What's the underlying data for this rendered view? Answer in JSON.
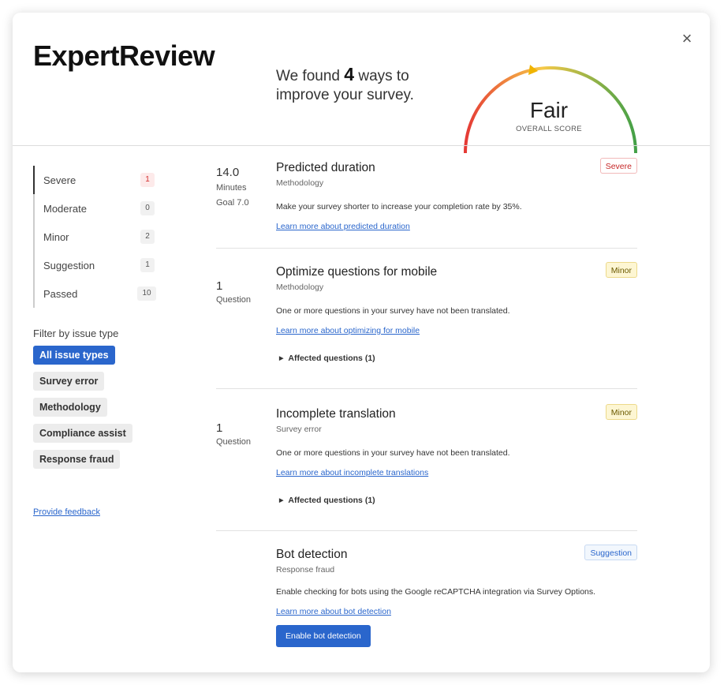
{
  "header": {
    "brand": "ExpertReview",
    "close_icon": "×",
    "found_prefix": "We found ",
    "found_count": "4",
    "found_suffix": " ways to improve your survey.",
    "score_label": "Fair",
    "score_caption": "OVERALL SCORE"
  },
  "gauge": {
    "colors": [
      "#e53935",
      "#f7c948",
      "#43a047"
    ],
    "level": 0.37
  },
  "severity": [
    {
      "label": "Severe",
      "count": "1",
      "count_color": "#d32f2f"
    },
    {
      "label": "Moderate",
      "count": "0"
    },
    {
      "label": "Minor",
      "count": "2"
    },
    {
      "label": "Suggestion",
      "count": "1"
    },
    {
      "label": "Passed",
      "count": "10"
    }
  ],
  "filter": {
    "title": "Filter by issue type",
    "chips": [
      "All issue types",
      "Survey error",
      "Methodology",
      "Compliance assist",
      "Response fraud"
    ]
  },
  "feedback_link": "Provide feedback",
  "cards": [
    {
      "metric": "14.0",
      "metric_sub": "Minutes",
      "metric_goal": "Goal 7.0",
      "title": "Predicted duration",
      "category": "Methodology",
      "badge": "Severe",
      "description": "Make your survey shorter to increase your completion rate by 35%.",
      "link": "Learn more about predicted duration"
    },
    {
      "metric": "1",
      "metric_sub": "Question",
      "title": "Optimize questions for mobile",
      "category": "Methodology",
      "badge": "Minor",
      "description": "One or more questions in your survey have not been translated.",
      "link": "Learn more about optimizing for mobile",
      "affected": "Affected questions (1)"
    },
    {
      "metric": "1",
      "metric_sub": "Question",
      "title": "Incomplete translation",
      "category": "Survey error",
      "badge": "Minor",
      "description": "One or more questions in your survey have not been translated.",
      "link": "Learn more about incomplete translations",
      "affected": "Affected questions (1)"
    },
    {
      "title": "Bot detection",
      "category": "Response fraud",
      "badge": "Suggestion",
      "description": "Enable checking for bots using the Google reCAPTCHA integration via Survey Options.",
      "link": "Learn more about bot detection",
      "button": "Enable bot detection"
    }
  ]
}
